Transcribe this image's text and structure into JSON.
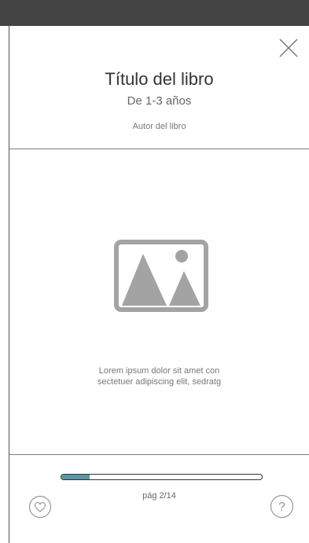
{
  "book": {
    "title": "Título del libro",
    "age_range": "De 1-3 años",
    "author": "Autor del libro"
  },
  "page_content": {
    "text_line_1": "Lorem ipsum dolor sit amet con",
    "text_line_2": "sectetuer adipiscing elit, sedratg"
  },
  "progress": {
    "current_page": 2,
    "total_pages": 14,
    "fraction": 0.143,
    "label": "pág 2/14"
  },
  "icons": {
    "close": "close-icon",
    "image": "image-placeholder-icon",
    "favorite": "heart-icon",
    "help": "question-mark-icon"
  },
  "colors": {
    "status_bar": "#444444",
    "progress_fill": "#5a96a6",
    "icon_gray": "#a3a3a3",
    "text": "#333333"
  },
  "help_glyph": "?"
}
